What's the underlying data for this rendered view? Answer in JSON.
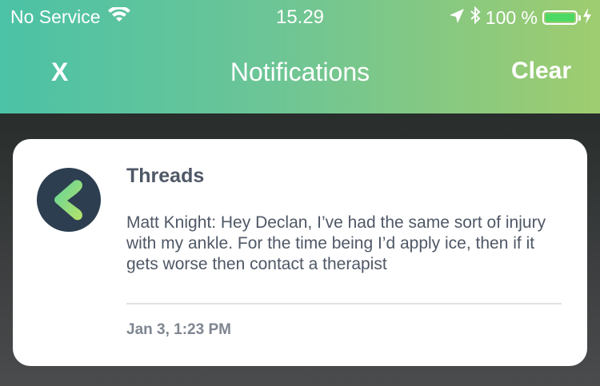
{
  "status_bar": {
    "carrier": "No Service",
    "time": "15.29",
    "battery_percent": "100 %",
    "icons": [
      "wifi-icon",
      "location-arrow-icon",
      "bluetooth-icon",
      "battery-icon",
      "charging-bolt-icon"
    ],
    "battery_level": 1.0,
    "battery_color": "#4cd964"
  },
  "navbar": {
    "close_label": "X",
    "title": "Notifications",
    "clear_label": "Clear"
  },
  "notification": {
    "app_name": "Threads",
    "message": "Matt Knight: Hey Declan, I’ve had the same sort of injury with my ankle. For the time being I’d apply ice, then if it gets worse then contact a therapist",
    "timestamp": "Jan 3, 1:23 PM",
    "icon": "threads-app-icon"
  },
  "colors": {
    "header_gradient": [
      "#4cc2a6",
      "#9fcc6f"
    ],
    "app_icon_bg": "#2c3e50"
  }
}
